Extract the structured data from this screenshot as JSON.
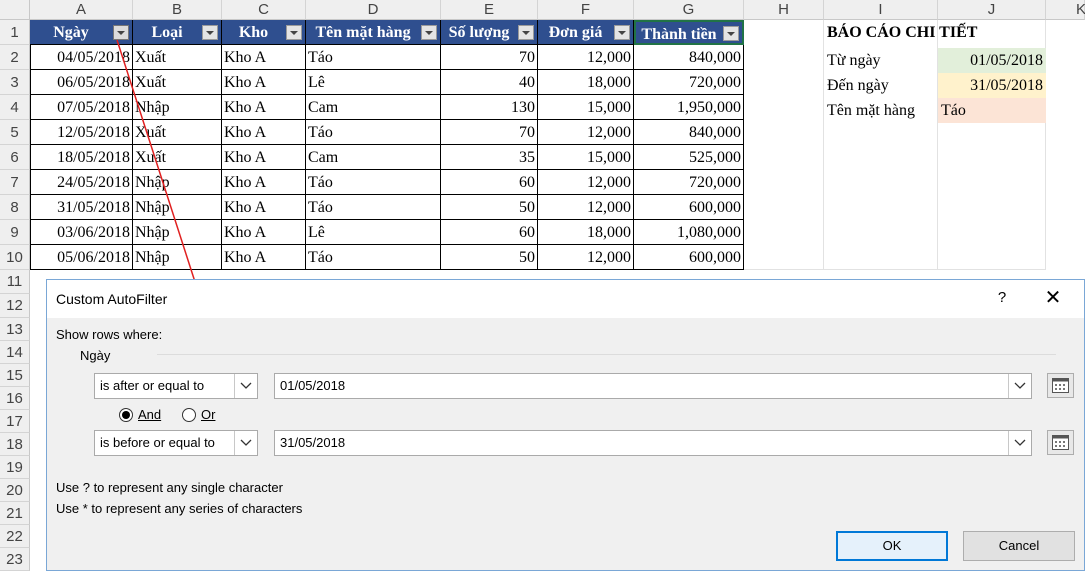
{
  "columns": [
    "A",
    "B",
    "C",
    "D",
    "E",
    "F",
    "G",
    "H",
    "I",
    "J",
    "K"
  ],
  "rows": [
    "1",
    "2",
    "3",
    "4",
    "5",
    "6",
    "7",
    "8",
    "9",
    "10",
    "11",
    "12",
    "13",
    "14",
    "15",
    "16",
    "17",
    "18",
    "19",
    "20",
    "21",
    "22",
    "23"
  ],
  "table": {
    "headers": [
      "Ngày",
      "Loại",
      "Kho",
      "Tên mặt hàng",
      "Số lượng",
      "Đơn giá",
      "Thành tiền"
    ],
    "data": [
      [
        "04/05/2018",
        "Xuất",
        "Kho A",
        "Táo",
        "70",
        "12,000",
        "840,000"
      ],
      [
        "06/05/2018",
        "Xuất",
        "Kho A",
        "Lê",
        "40",
        "18,000",
        "720,000"
      ],
      [
        "07/05/2018",
        "Nhập",
        "Kho A",
        "Cam",
        "130",
        "15,000",
        "1,950,000"
      ],
      [
        "12/05/2018",
        "Xuất",
        "Kho A",
        "Táo",
        "70",
        "12,000",
        "840,000"
      ],
      [
        "18/05/2018",
        "Xuất",
        "Kho A",
        "Cam",
        "35",
        "15,000",
        "525,000"
      ],
      [
        "24/05/2018",
        "Nhập",
        "Kho A",
        "Táo",
        "60",
        "12,000",
        "720,000"
      ],
      [
        "31/05/2018",
        "Nhập",
        "Kho A",
        "Táo",
        "50",
        "12,000",
        "600,000"
      ],
      [
        "03/06/2018",
        "Nhập",
        "Kho A",
        "Lê",
        "60",
        "18,000",
        "1,080,000"
      ],
      [
        "05/06/2018",
        "Nhập",
        "Kho A",
        "Táo",
        "50",
        "12,000",
        "600,000"
      ]
    ]
  },
  "report": {
    "title": "BÁO CÁO CHI TIẾT",
    "from_label": "Từ ngày",
    "from_value": "01/05/2018",
    "to_label": "Đến ngày",
    "to_value": "31/05/2018",
    "item_label": "Tên mặt hàng",
    "item_value": "Táo"
  },
  "dialog": {
    "title": "Custom AutoFilter",
    "help": "?",
    "close": "✕",
    "show_rows": "Show rows where:",
    "field": "Ngày",
    "op1": "is after or equal to",
    "val1": "01/05/2018",
    "op2": "is before or equal to",
    "val2": "31/05/2018",
    "and_label": "And",
    "or_label": "Or",
    "hint1": "Use ? to represent any single character",
    "hint2": "Use * to represent any series of characters",
    "ok": "OK",
    "cancel": "Cancel"
  },
  "colors": {
    "header_fill": "#2f4f8f",
    "from_fill": "#e2efda",
    "to_fill": "#fff2cc",
    "item_fill": "#fce4d6",
    "arrow": "#e02020"
  }
}
